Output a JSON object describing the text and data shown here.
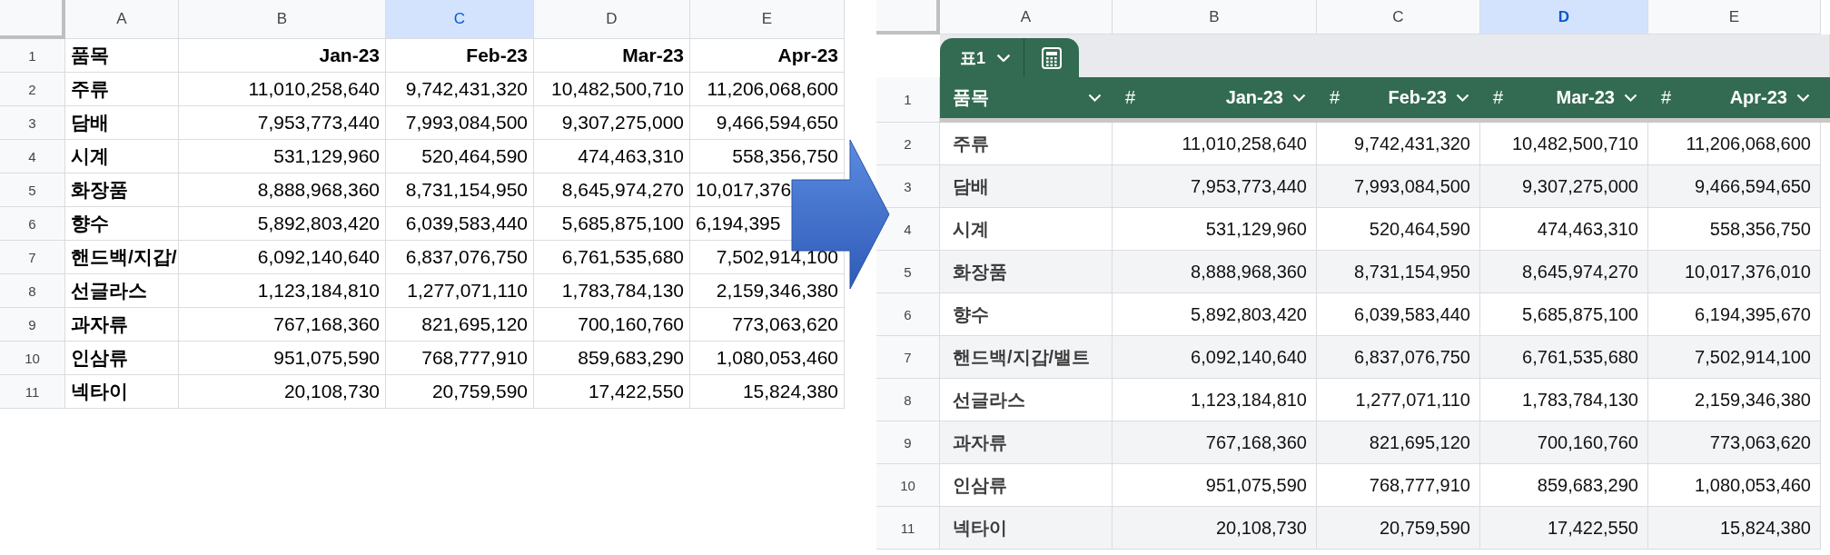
{
  "left_sheet": {
    "columns": [
      {
        "label": "A",
        "selected": false
      },
      {
        "label": "B",
        "selected": false
      },
      {
        "label": "C",
        "selected": true
      },
      {
        "label": "D",
        "selected": false
      },
      {
        "label": "E",
        "selected": false
      }
    ],
    "rows": [
      {
        "number": "1",
        "cells": [
          "품목",
          "Jan-23",
          "Feb-23",
          "Mar-23",
          "Apr-23"
        ]
      },
      {
        "number": "2",
        "cells": [
          "주류",
          "11,010,258,640",
          "9,742,431,320",
          "10,482,500,710",
          "11,206,068,600"
        ]
      },
      {
        "number": "3",
        "cells": [
          "담배",
          "7,953,773,440",
          "7,993,084,500",
          "9,307,275,000",
          "9,466,594,650"
        ]
      },
      {
        "number": "4",
        "cells": [
          "시계",
          "531,129,960",
          "520,464,590",
          "474,463,310",
          "558,356,750"
        ]
      },
      {
        "number": "5",
        "cells": [
          "화장품",
          "8,888,968,360",
          "8,731,154,950",
          "8,645,974,270",
          {
            "text": "10,017,376",
            "covered": true
          }
        ]
      },
      {
        "number": "6",
        "cells": [
          "향수",
          "5,892,803,420",
          "6,039,583,440",
          "5,685,875,100",
          {
            "text": "6,194,395",
            "covered": true
          }
        ]
      },
      {
        "number": "7",
        "cells": [
          "핸드백/지갑/",
          "6,092,140,640",
          "6,837,076,750",
          "6,761,535,680",
          "7,502,914,100"
        ]
      },
      {
        "number": "8",
        "cells": [
          "선글라스",
          "1,123,184,810",
          "1,277,071,110",
          "1,783,784,130",
          "2,159,346,380"
        ]
      },
      {
        "number": "9",
        "cells": [
          "과자류",
          "767,168,360",
          "821,695,120",
          "700,160,760",
          "773,063,620"
        ]
      },
      {
        "number": "10",
        "cells": [
          "인삼류",
          "951,075,590",
          "768,777,910",
          "859,683,290",
          "1,080,053,460"
        ]
      },
      {
        "number": "11",
        "cells": [
          "넥타이",
          "20,108,730",
          "20,759,590",
          "17,422,550",
          "15,824,380"
        ]
      }
    ]
  },
  "right_sheet": {
    "columns": [
      {
        "label": "A",
        "selected": false
      },
      {
        "label": "B",
        "selected": false
      },
      {
        "label": "C",
        "selected": false
      },
      {
        "label": "D",
        "selected": true
      },
      {
        "label": "E",
        "selected": false
      }
    ],
    "table_tab": {
      "name": "표1"
    },
    "header_row": {
      "number": "1",
      "cells": [
        {
          "text": "품목"
        },
        {
          "text": "Jan-23",
          "type_symbol": "#"
        },
        {
          "text": "Feb-23",
          "type_symbol": "#"
        },
        {
          "text": "Mar-23",
          "type_symbol": "#"
        },
        {
          "text": "Apr-23",
          "type_symbol": "#"
        }
      ]
    },
    "rows": [
      {
        "number": "2",
        "cells": [
          "주류",
          "11,010,258,640",
          "9,742,431,320",
          "10,482,500,710",
          "11,206,068,600"
        ]
      },
      {
        "number": "3",
        "cells": [
          "담배",
          "7,953,773,440",
          "7,993,084,500",
          "9,307,275,000",
          "9,466,594,650"
        ]
      },
      {
        "number": "4",
        "cells": [
          "시계",
          "531,129,960",
          "520,464,590",
          "474,463,310",
          "558,356,750"
        ]
      },
      {
        "number": "5",
        "cells": [
          "화장품",
          "8,888,968,360",
          "8,731,154,950",
          "8,645,974,270",
          "10,017,376,010"
        ]
      },
      {
        "number": "6",
        "cells": [
          "향수",
          "5,892,803,420",
          "6,039,583,440",
          "5,685,875,100",
          "6,194,395,670"
        ]
      },
      {
        "number": "7",
        "cells": [
          "핸드백/지갑/밸트",
          "6,092,140,640",
          "6,837,076,750",
          "6,761,535,680",
          "7,502,914,100"
        ]
      },
      {
        "number": "8",
        "cells": [
          "선글라스",
          "1,123,184,810",
          "1,277,071,110",
          "1,783,784,130",
          "2,159,346,380"
        ]
      },
      {
        "number": "9",
        "cells": [
          "과자류",
          "767,168,360",
          "821,695,120",
          "700,160,760",
          "773,063,620"
        ]
      },
      {
        "number": "10",
        "cells": [
          "인삼류",
          "951,075,590",
          "768,777,910",
          "859,683,290",
          "1,080,053,460"
        ]
      },
      {
        "number": "11",
        "cells": [
          "넥타이",
          "20,108,730",
          "20,759,590",
          "17,422,550",
          "15,824,380"
        ]
      }
    ]
  }
}
